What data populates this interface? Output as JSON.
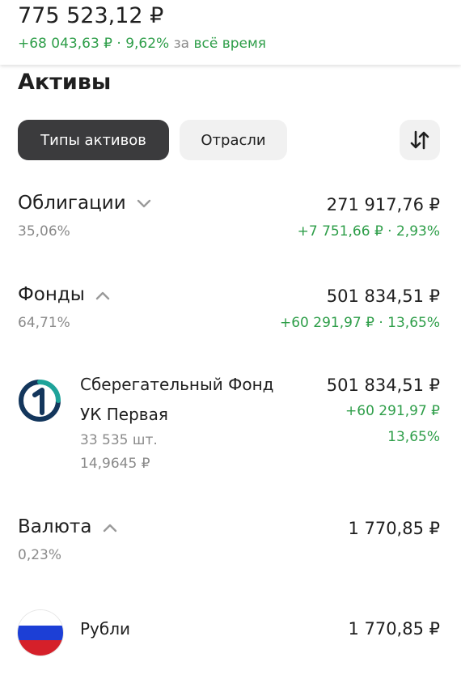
{
  "summary": {
    "total_value": "775 523,12 ₽",
    "change_amount": "+68 043,63 ₽ · 9,62%",
    "change_suffix_pre": "за",
    "change_suffix_post": "всё время"
  },
  "section": {
    "title": "Активы",
    "tabs": [
      {
        "label": "Типы активов",
        "active": true
      },
      {
        "label": "Отрасли",
        "active": false
      }
    ],
    "sort_icon": "sort-arrows-icon"
  },
  "groups": [
    {
      "name": "Облигации",
      "percent": "35,06%",
      "amount": "271 917,76 ₽",
      "change": "+7 751,66 ₽ · 2,93%",
      "expanded": false
    },
    {
      "name": "Фонды",
      "percent": "64,71%",
      "amount": "501 834,51 ₽",
      "change": "+60 291,97 ₽ · 13,65%",
      "expanded": true
    },
    {
      "name": "Валюта",
      "percent": "0,23%",
      "amount": "1 770,85 ₽",
      "expanded": true
    }
  ],
  "fund": {
    "name_line1": "Сберегательный Фонд",
    "name_line2": "УК Первая",
    "quantity": "33 535 шт.",
    "price": "14,9645 ₽",
    "amount": "501 834,51 ₽",
    "change_amount": "+60 291,97 ₽",
    "change_percent": "13,65%"
  },
  "currency_item": {
    "name": "Рубли",
    "amount": "1 770,85 ₽",
    "flag_colors": [
      "#ffffff",
      "#1c3fd6",
      "#d5202a"
    ]
  },
  "colors": {
    "accent_green": "#2e9e49",
    "pill_active": "#3b3b3d",
    "pill_inactive": "#f1f1f1",
    "logo_teal": "#1ea39a",
    "logo_navy": "#13365c"
  }
}
